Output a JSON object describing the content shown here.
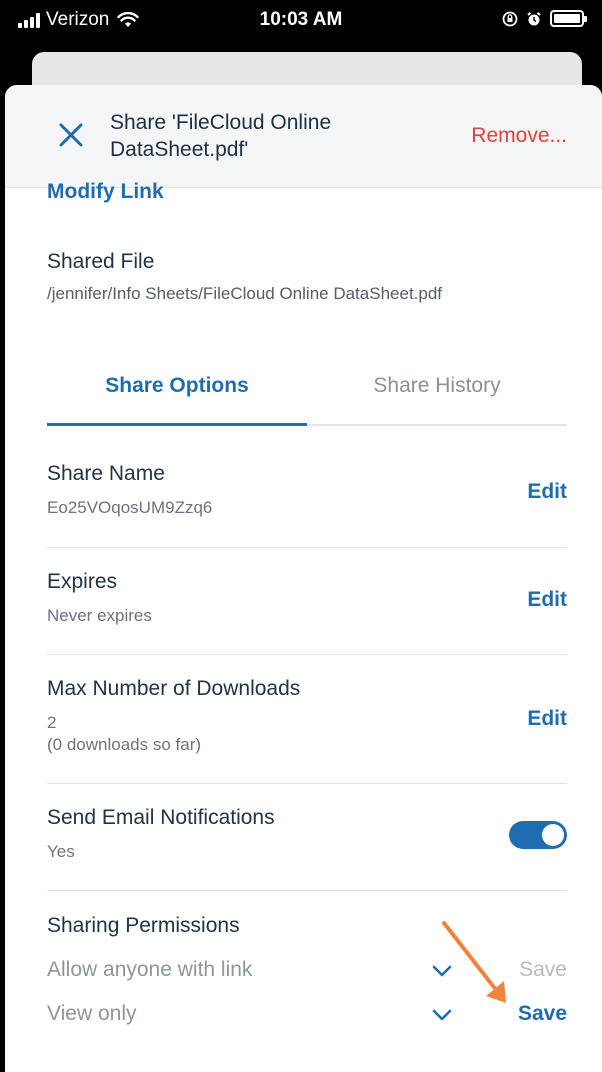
{
  "status_bar": {
    "carrier": "Verizon",
    "time": "10:03 AM",
    "icons": [
      "signal-icon",
      "wifi-icon",
      "orientation-lock-icon",
      "alarm-icon",
      "battery-icon"
    ]
  },
  "header": {
    "title": "Share 'FileCloud Online DataSheet.pdf'",
    "remove_label": "Remove..."
  },
  "modify_link": "Modify Link",
  "shared_file": {
    "title": "Shared File",
    "path": "/jennifer/Info Sheets/FileCloud Online DataSheet.pdf"
  },
  "tabs": [
    {
      "label": "Share Options",
      "active": true
    },
    {
      "label": "Share History",
      "active": false
    }
  ],
  "options": {
    "share_name": {
      "title": "Share Name",
      "value": "Eo25VOqosUM9Zzq6",
      "action": "Edit"
    },
    "expires": {
      "title": "Expires",
      "value": "Never expires",
      "action": "Edit"
    },
    "max_downloads": {
      "title": "Max Number of Downloads",
      "value": "2",
      "note": "(0 downloads so far)",
      "action": "Edit"
    },
    "email_notifications": {
      "title": "Send Email Notifications",
      "value": "Yes",
      "toggle_on": true
    }
  },
  "permissions": {
    "title": "Sharing Permissions",
    "lines": [
      {
        "value": "Allow anyone with link",
        "save_label": "Save",
        "save_enabled": false
      },
      {
        "value": "View only",
        "save_label": "Save",
        "save_enabled": true
      }
    ]
  },
  "colors": {
    "accent": "#1f6db0",
    "remove": "#e2403c",
    "annotation_arrow": "#f0843c"
  }
}
